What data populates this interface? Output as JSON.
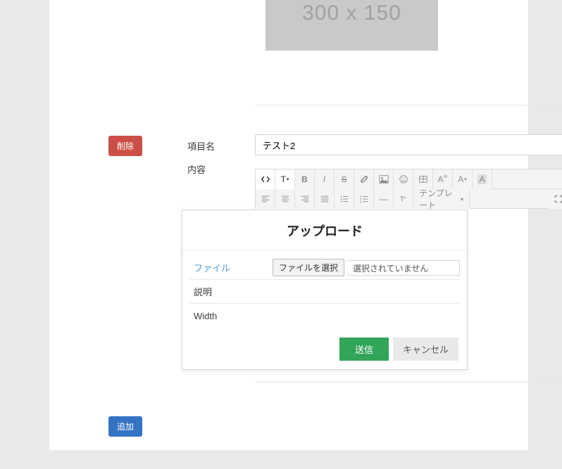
{
  "placeholder": {
    "text": "300 x 150"
  },
  "buttons": {
    "delete": "削除",
    "add": "追加"
  },
  "labels": {
    "item_name": "項目名",
    "content": "内容"
  },
  "inputs": {
    "item_name_value": "テスト2"
  },
  "toolbar": {
    "template_label": "テンプレート"
  },
  "modal": {
    "title": "アップロード",
    "file_label": "ファイル",
    "file_button": "ファイルを選択",
    "file_status": "選択されていません",
    "desc_label": "説明",
    "width_label": "Width",
    "submit": "送信",
    "cancel": "キャンセル"
  }
}
